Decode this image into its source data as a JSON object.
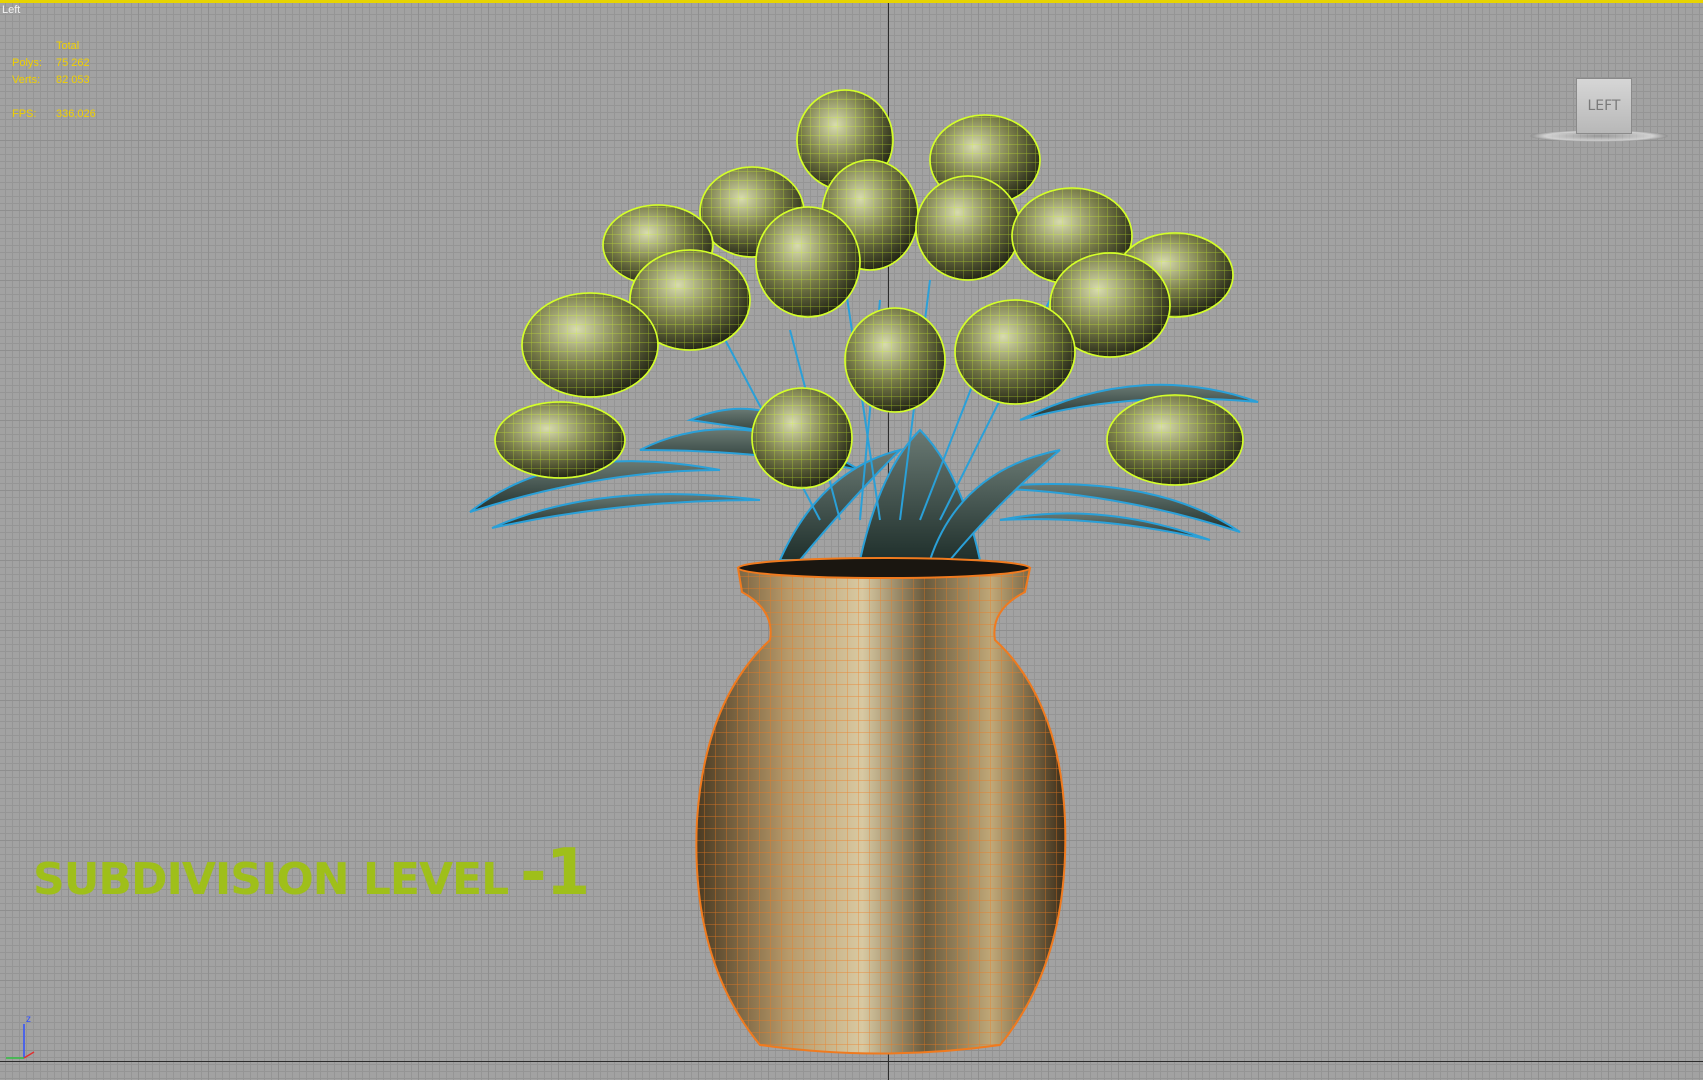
{
  "viewport": {
    "label": "Left",
    "view_cube_face": "LEFT"
  },
  "stats": {
    "header": "Total",
    "polys_label": "Polys:",
    "polys_value": "75 262",
    "verts_label": "Verts:",
    "verts_value": "82 053",
    "fps_label": "FPS:",
    "fps_value": "336,026"
  },
  "caption": {
    "text": "SUBDIVISION LEVEL",
    "level": "-1"
  },
  "axis_tripod": {
    "z_label": "z"
  },
  "colors": {
    "active_border": "#e8d400",
    "stats_text": "#f0d000",
    "flower_wire": "#d4ff2a",
    "leaf_wire": "#2aa0d8",
    "vase_wire": "#f07a1e",
    "caption": "#9fbf1a"
  }
}
